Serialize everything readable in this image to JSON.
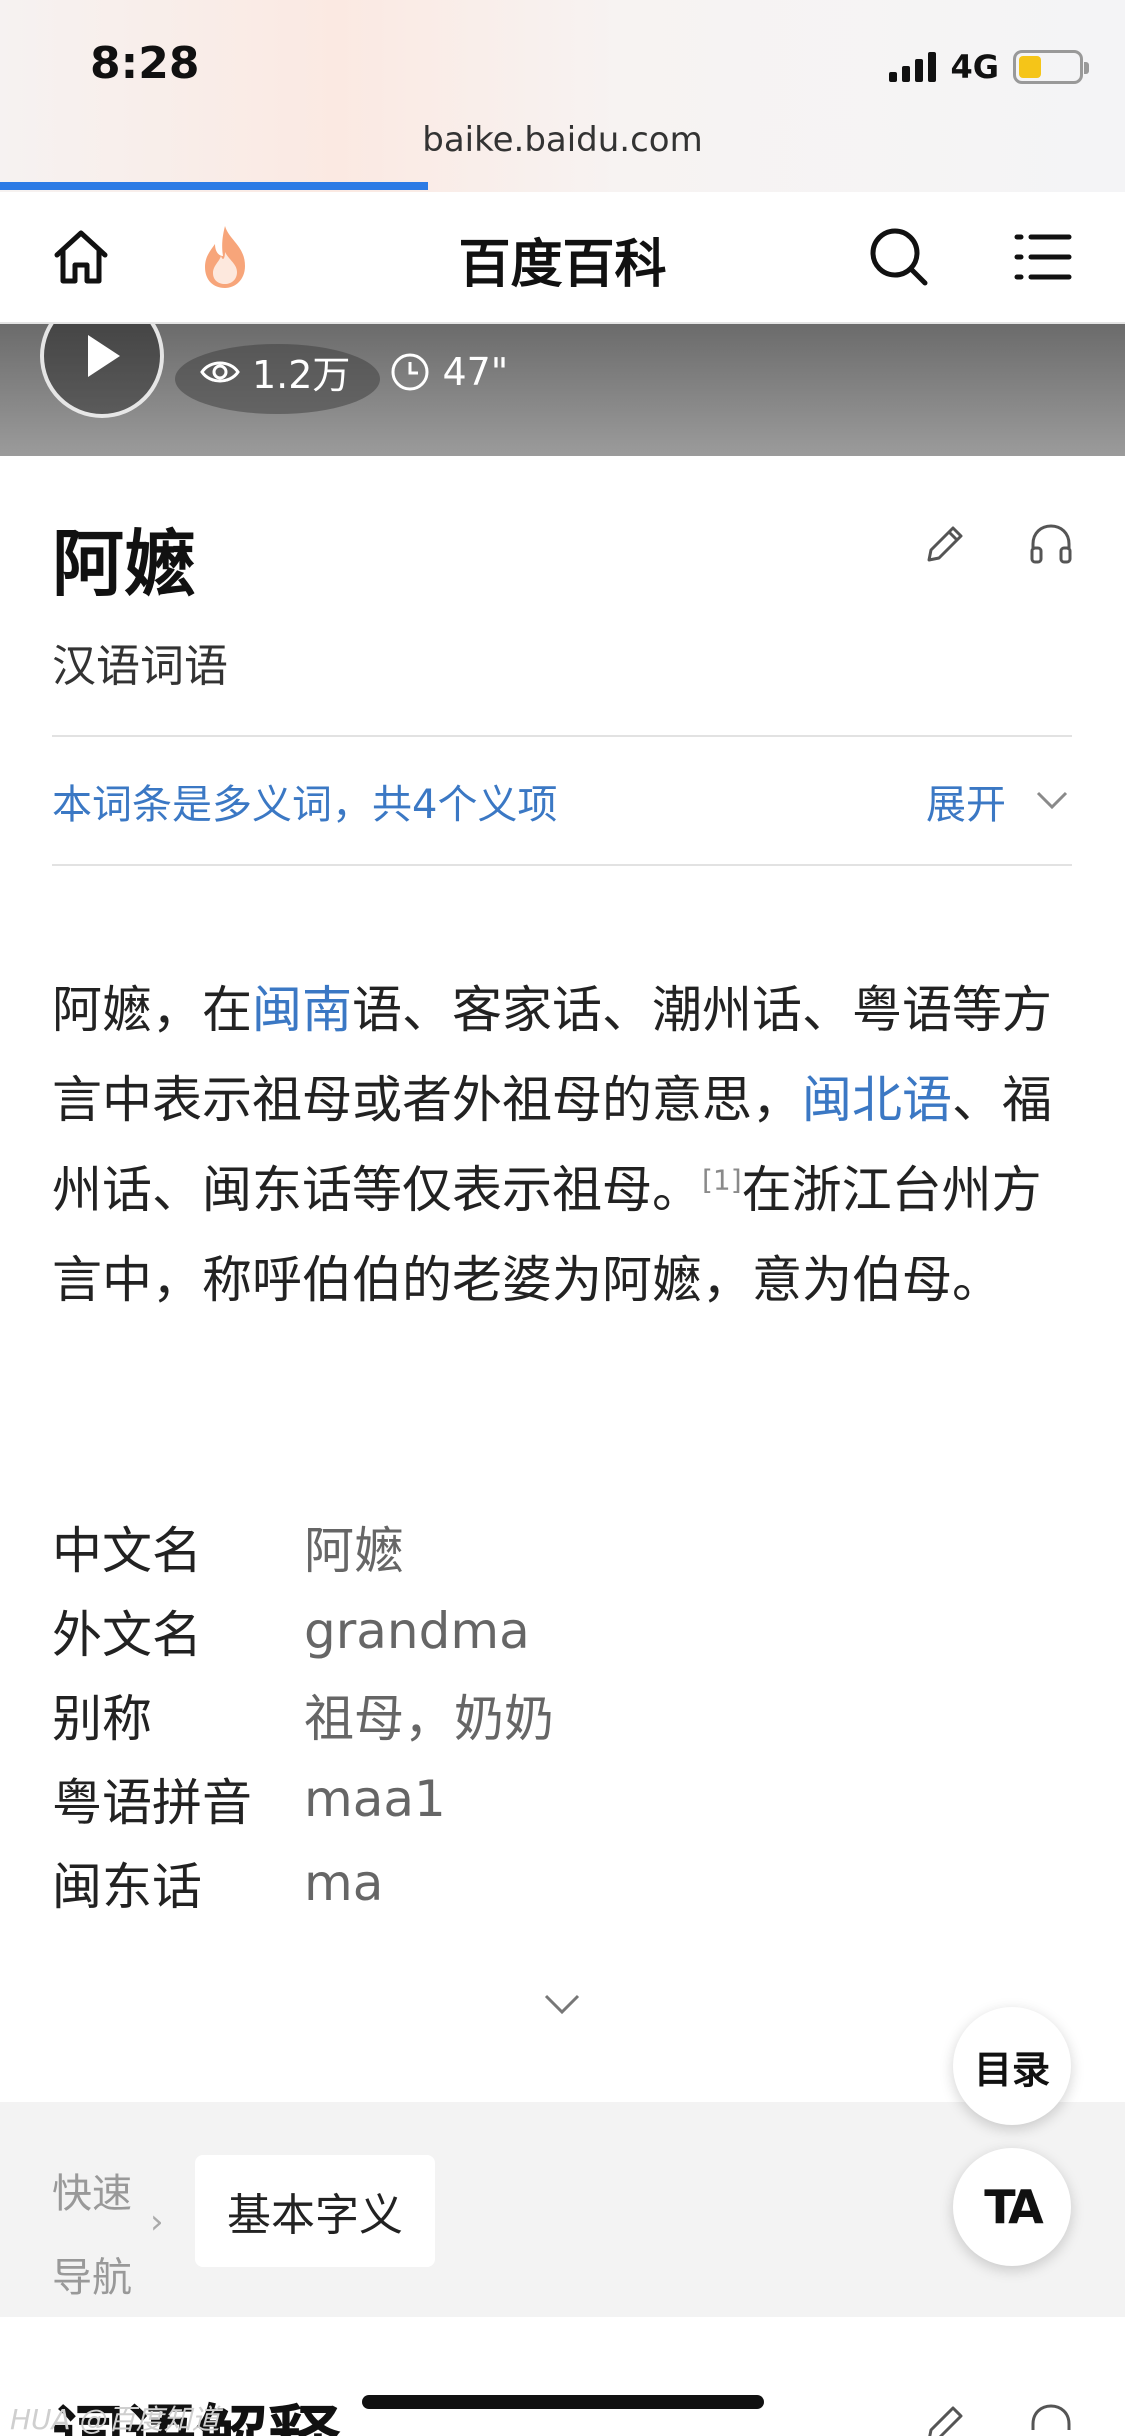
{
  "status": {
    "time": "8:28",
    "network": "4G"
  },
  "browser": {
    "url": "baike.baidu.com",
    "load_progress_percent": 38
  },
  "nav": {
    "title": "百度百科"
  },
  "video": {
    "views": "1.2万",
    "duration": "47\""
  },
  "entry": {
    "title": "阿嬷",
    "subtitle": "汉语词语",
    "polysemy_notice": "本词条是多义词，共4个义项",
    "expand_label": "展开"
  },
  "summary": {
    "p1": "阿嬷，在",
    "link1": "闽南",
    "p2": "语、客家话、潮州话、粤语等方言中表示祖母或者外祖母的意思，",
    "link2": "闽北语",
    "p3": "、福州话、闽东话等仅表示祖母。",
    "ref": "[1]",
    "p4": "在浙江台州方言中，称呼伯伯的老婆为阿嬷，意为伯母。"
  },
  "infobox": [
    {
      "key": "中文名",
      "value": "阿嬷"
    },
    {
      "key": "外文名",
      "value": "grandma"
    },
    {
      "key": "别称",
      "value": "祖母，奶奶"
    },
    {
      "key": "粤语拼音",
      "value": "maa1"
    },
    {
      "key": "闽东话",
      "value": "ma"
    }
  ],
  "floating": {
    "toc_label": "目录",
    "font_label": "TA"
  },
  "quick_nav": {
    "label": "快速导航",
    "chip": "基本字义"
  },
  "next_section": {
    "title": "词语解释"
  },
  "watermark": "HUA @百度知道"
}
